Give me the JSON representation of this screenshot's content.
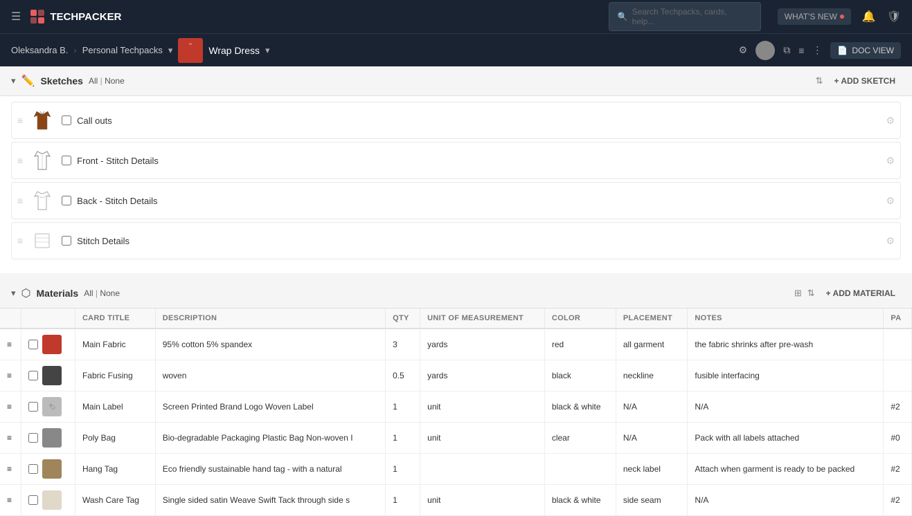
{
  "nav": {
    "hamburger": "☰",
    "logo": "TECHPACKER",
    "search_placeholder": "Search Techpacks, cards, help...",
    "whats_new": "WHAT'S NEW",
    "search_icon": "🔍"
  },
  "breadcrumb": {
    "user": "Oleksandra B.",
    "workspace": "Personal Techpacks",
    "project": "Wrap Dress",
    "doc_view": "DOC VIEW"
  },
  "sketches": {
    "title": "Sketches",
    "filter_all": "All",
    "filter_none": "None",
    "add_label": "+ ADD SKETCH",
    "items": [
      {
        "name": "Call outs",
        "type": "dress"
      },
      {
        "name": "Front - Stitch Details",
        "type": "front"
      },
      {
        "name": "Back - Stitch Details",
        "type": "back"
      },
      {
        "name": "Stitch Details",
        "type": "detail"
      }
    ]
  },
  "materials": {
    "title": "Materials",
    "filter_all": "All",
    "filter_none": "None",
    "add_label": "+ ADD MATERIAL",
    "columns": {
      "card_title": "Card Title",
      "description": "DESCRIPTION",
      "qty": "QTY",
      "unit": "UNIT OF MEASUREMENT",
      "color": "COLOR",
      "placement": "PLACEMENT",
      "notes": "NOTES",
      "pa": "PA"
    },
    "rows": [
      {
        "title": "Main Fabric",
        "description": "95% cotton 5% spandex",
        "qty": "3",
        "unit": "yards",
        "color": "red",
        "placement": "all garment",
        "notes": "the fabric shrinks after pre-wash",
        "pa": "",
        "swatch": "red"
      },
      {
        "title": "Fabric Fusing",
        "description": "woven",
        "qty": "0.5",
        "unit": "yards",
        "color": "black",
        "placement": "neckline",
        "notes": "fusible interfacing",
        "pa": "",
        "swatch": "dark"
      },
      {
        "title": "Main Label",
        "description": "Screen Printed Brand Logo Woven Label",
        "qty": "1",
        "unit": "unit",
        "color": "black & white",
        "placement": "N/A",
        "notes": "N/A",
        "pa": "#2",
        "swatch": "label"
      },
      {
        "title": "Poly Bag",
        "description": "Bio-degradable Packaging Plastic Bag Non-woven I",
        "qty": "1",
        "unit": "unit",
        "color": "clear",
        "placement": "N/A",
        "notes": "Pack with all labels attached",
        "pa": "#0",
        "swatch": "poly"
      },
      {
        "title": "Hang Tag",
        "description": "Eco friendly sustainable hand tag - with a natural",
        "qty": "1",
        "unit": "",
        "color": "",
        "placement": "neck label",
        "notes": "Attach when garment is ready to be packed",
        "pa": "#2",
        "swatch": "hang"
      },
      {
        "title": "Wash Care Tag",
        "description": "Single sided satin Weave Swift Tack through side s",
        "qty": "1",
        "unit": "unit",
        "color": "black & white",
        "placement": "side seam",
        "notes": "N/A",
        "pa": "#2",
        "swatch": "wash"
      }
    ]
  }
}
